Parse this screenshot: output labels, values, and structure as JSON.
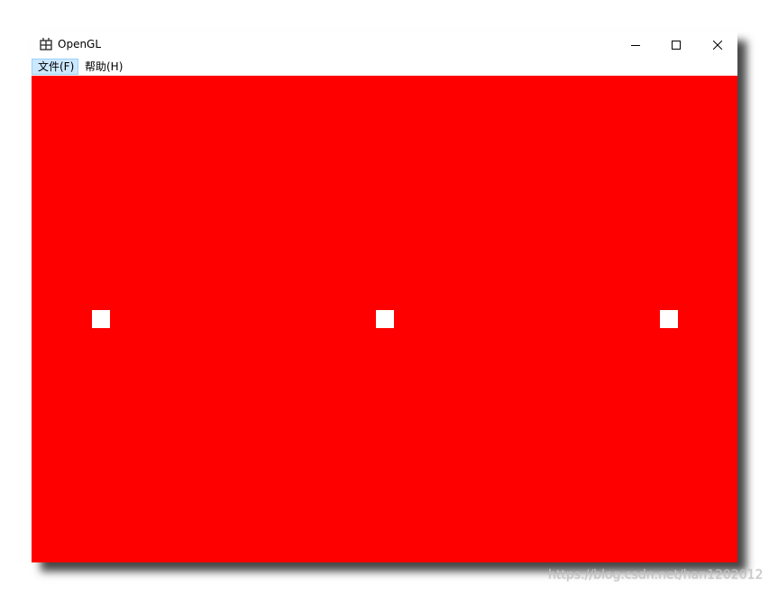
{
  "window": {
    "title": "OpenGL",
    "icon": "app-window-icon",
    "controls": {
      "minimize": "minimize-icon",
      "maximize": "maximize-icon",
      "close": "close-icon"
    }
  },
  "menu": {
    "items": [
      {
        "label": "文件(F)",
        "accelerator": "F",
        "highlighted": true
      },
      {
        "label": "帮助(H)",
        "accelerator": "H",
        "highlighted": false
      }
    ]
  },
  "canvas": {
    "background_color": "#ff0000",
    "point_color": "#ffffff",
    "points_count": 3
  },
  "watermark": {
    "text": "https://blog.csdn.net/han1202012"
  }
}
